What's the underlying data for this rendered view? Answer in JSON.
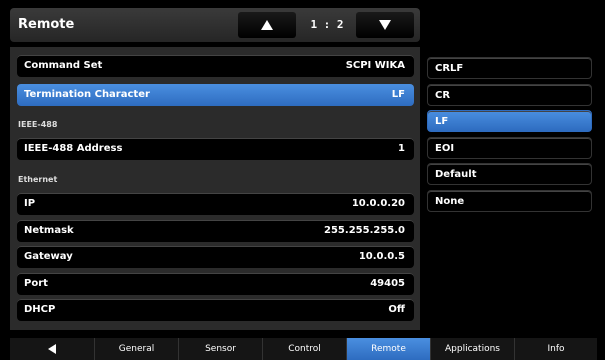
{
  "header": {
    "title": "Remote",
    "page_indicator": "1 : 2"
  },
  "settings": {
    "command_set": {
      "label": "Command Set",
      "value": "SCPI WIKA"
    },
    "termination": {
      "label": "Termination Character",
      "value": "LF"
    },
    "ieee_section": "IEEE-488",
    "ieee_address": {
      "label": "IEEE-488 Address",
      "value": "1"
    },
    "ethernet_section": "Ethernet",
    "ip": {
      "label": "IP",
      "value": "10.0.0.20"
    },
    "netmask": {
      "label": "Netmask",
      "value": "255.255.255.0"
    },
    "gateway": {
      "label": "Gateway",
      "value": "10.0.0.5"
    },
    "port": {
      "label": "Port",
      "value": "49405"
    },
    "dhcp": {
      "label": "DHCP",
      "value": "Off"
    }
  },
  "options": [
    "CRLF",
    "CR",
    "LF",
    "EOI",
    "Default",
    "None"
  ],
  "selected_option": "LF",
  "tabs": [
    "General",
    "Sensor",
    "Control",
    "Remote",
    "Applications",
    "Info"
  ],
  "active_tab": "Remote",
  "colors": {
    "accent": "#3a7fd5",
    "background": "#000000",
    "panel": "#2b2b2b"
  },
  "icons": {
    "page_up": "triangle-up-icon",
    "page_down": "triangle-down-icon",
    "back": "triangle-left-icon"
  }
}
